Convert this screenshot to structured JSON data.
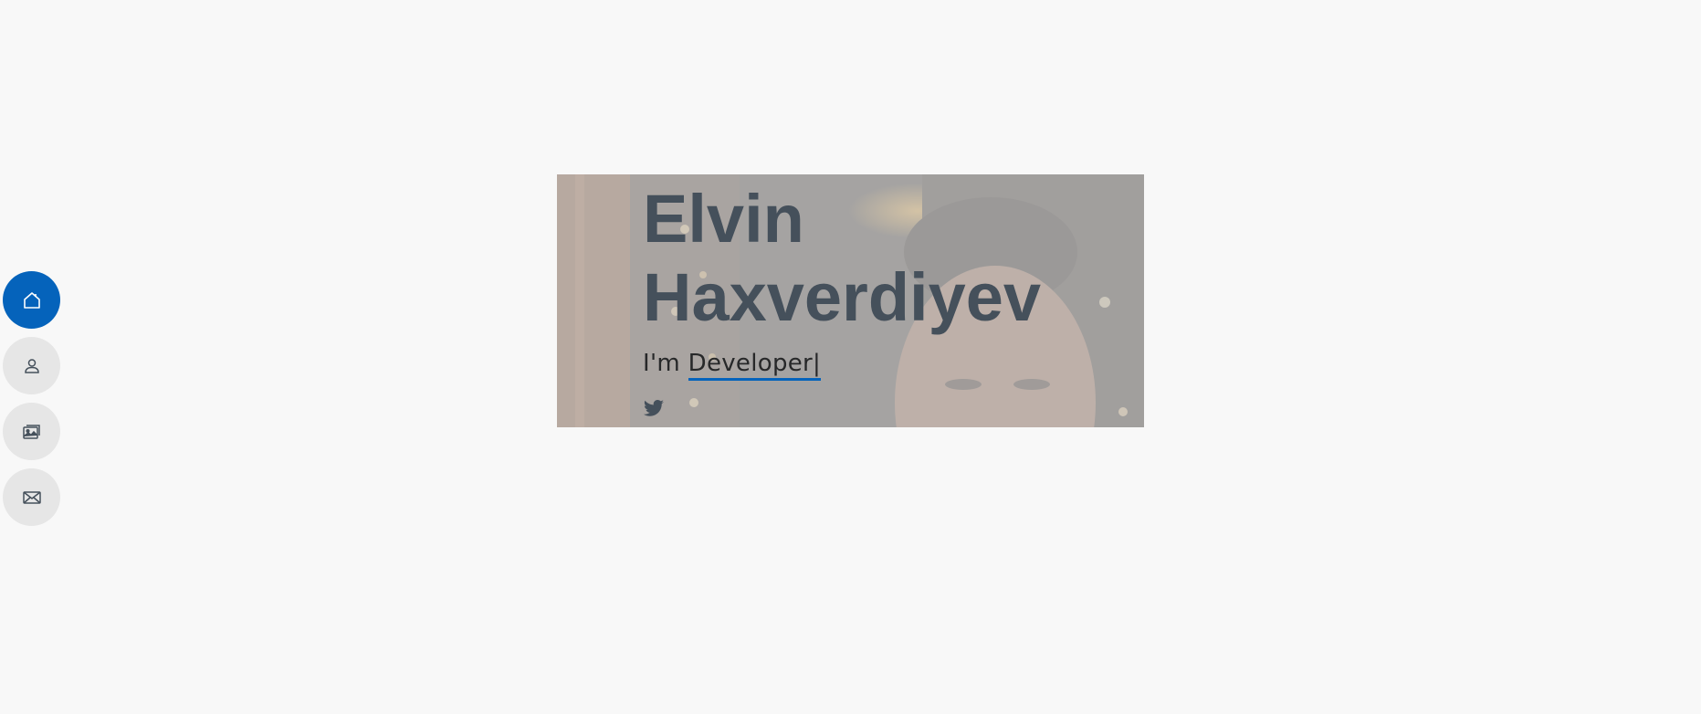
{
  "sidebar": {
    "items": [
      {
        "icon": "home-icon",
        "active": true
      },
      {
        "icon": "person-icon",
        "active": false
      },
      {
        "icon": "images-icon",
        "active": false
      },
      {
        "icon": "envelope-icon",
        "active": false
      }
    ]
  },
  "hero": {
    "first_name": "Elvin",
    "last_name": "Haxverdiyev",
    "prefix": "I'm",
    "typed_word": "Developer",
    "cursor": "|",
    "social": [
      "twitter-icon"
    ]
  },
  "colors": {
    "accent": "#0563bb",
    "heading": "#45505b",
    "text": "#272829",
    "background": "#f8f8f8",
    "nav_inactive": "#e6e6e6"
  }
}
